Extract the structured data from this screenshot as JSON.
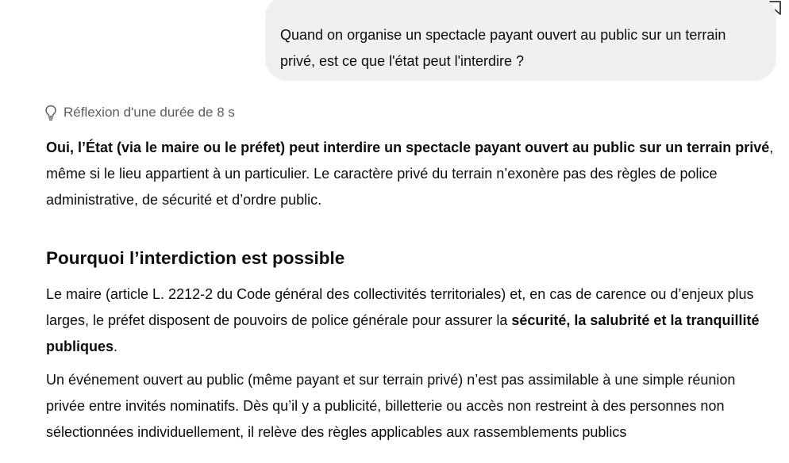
{
  "icons": {
    "top_left": "download-icon",
    "top_right": "bookmark-icon",
    "reflection": "lightbulb-icon"
  },
  "user_message": "Quand on organise un spectacle payant ouvert au public sur un terrain privé, est ce que l'état peut l'interdire ?",
  "reflection": {
    "label": "Réflexion d'une durée de 8 s"
  },
  "answer": {
    "intro_bold": "Oui, l’État (via le maire ou le préfet) peut interdire un spectacle payant ouvert au public sur un terrain privé",
    "intro_rest": ", même si le lieu appartient à un particulier. Le caractère privé du terrain n’exonère pas des règles de police administrative, de sécurité et d’ordre public.",
    "heading": "Pourquoi l’interdiction est possible",
    "p_mayor_text": "Le maire (article L. 2212-2 du Code général des collectivités territoriales) et, en cas de carence ou d’enjeux plus larges, le préfet disposent de pouvoirs de police générale pour assurer la ",
    "p_mayor_bold": "sécurité, la salubrité et la tranquillité publiques",
    "p_mayor_end": ".",
    "p_event": "Un événement ouvert au public (même payant et sur terrain privé) n’est pas assimilable à une simple réunion privée entre invités nominatifs. Dès qu’il y a publicité, billetterie ou accès non restreint à des personnes non sélectionnées individuellement, il relève des règles applicables aux rassemblements publics"
  }
}
